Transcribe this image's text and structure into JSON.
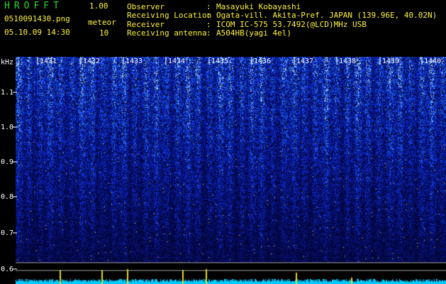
{
  "header": {
    "app_title": "HROFFT",
    "app_version": "1.00",
    "file_name": "0510091430.png",
    "meteor_label": "meteor",
    "date_time": "05.10.09 14:30",
    "meteor_count": "10"
  },
  "station": [
    {
      "label": "Observer",
      "value": "Masayuki Kobayashi"
    },
    {
      "label": "Receiving Location",
      "value": "Ogata-vill. Akita-Pref. JAPAN (139.96E, 40.02N)"
    },
    {
      "label": "Receiver",
      "value": "ICOM IC-575 53.7492(@LCD)MHz USB"
    },
    {
      "label": "Receiving antenna",
      "value": "A504HB(yagi 4el)"
    }
  ],
  "spectrogram": {
    "freq_unit": "kHz",
    "freq_ticks": [
      "1.1",
      "1.0",
      "0.9",
      "0.8",
      "0.7",
      "0.6"
    ],
    "time_ticks": [
      "1431",
      "1432",
      "1433",
      "1434",
      "1435",
      "1436",
      "1437",
      "1438",
      "1439",
      "1440"
    ]
  },
  "colors": {
    "header_green": "#22e02c",
    "header_yellow": "#fff23a",
    "spectrum_blue": "#1a3cff",
    "signal_strip": "#00c8ff"
  }
}
